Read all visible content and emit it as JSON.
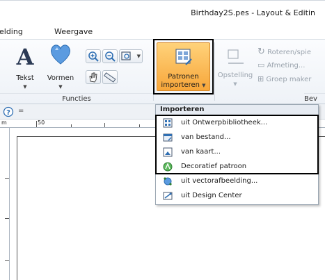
{
  "window": {
    "title": "Birthday2S.pes - Layout & Editin"
  },
  "menubar": {
    "items": [
      "elding",
      "Weergave"
    ]
  },
  "ribbon": {
    "functions": {
      "label": "Functies",
      "text_button": "Tekst",
      "shapes_button": "Vormen"
    },
    "import_button": {
      "line1": "Patronen",
      "line2": "importeren"
    },
    "arrange": {
      "layout_button": "Opstelling",
      "rotate": "Roteren/spie",
      "measure": "Afmeting...",
      "group": "Groep maker",
      "partial_group_label": "Bev"
    }
  },
  "import_menu": {
    "header": "Importeren",
    "items": [
      {
        "label": "uit Ontwerpbibliotheek...",
        "icon": "library-icon"
      },
      {
        "label": "van bestand...",
        "icon": "file-icon"
      },
      {
        "label": "van kaart...",
        "icon": "card-icon"
      },
      {
        "label": "Decoratief patroon",
        "icon": "decorative-pattern-icon"
      },
      {
        "label": "uit vectorafbeelding...",
        "icon": "vector-icon"
      },
      {
        "label": "uit Design Center",
        "icon": "design-center-icon"
      }
    ]
  },
  "ruler": {
    "mark": "50",
    "unit": "m"
  }
}
